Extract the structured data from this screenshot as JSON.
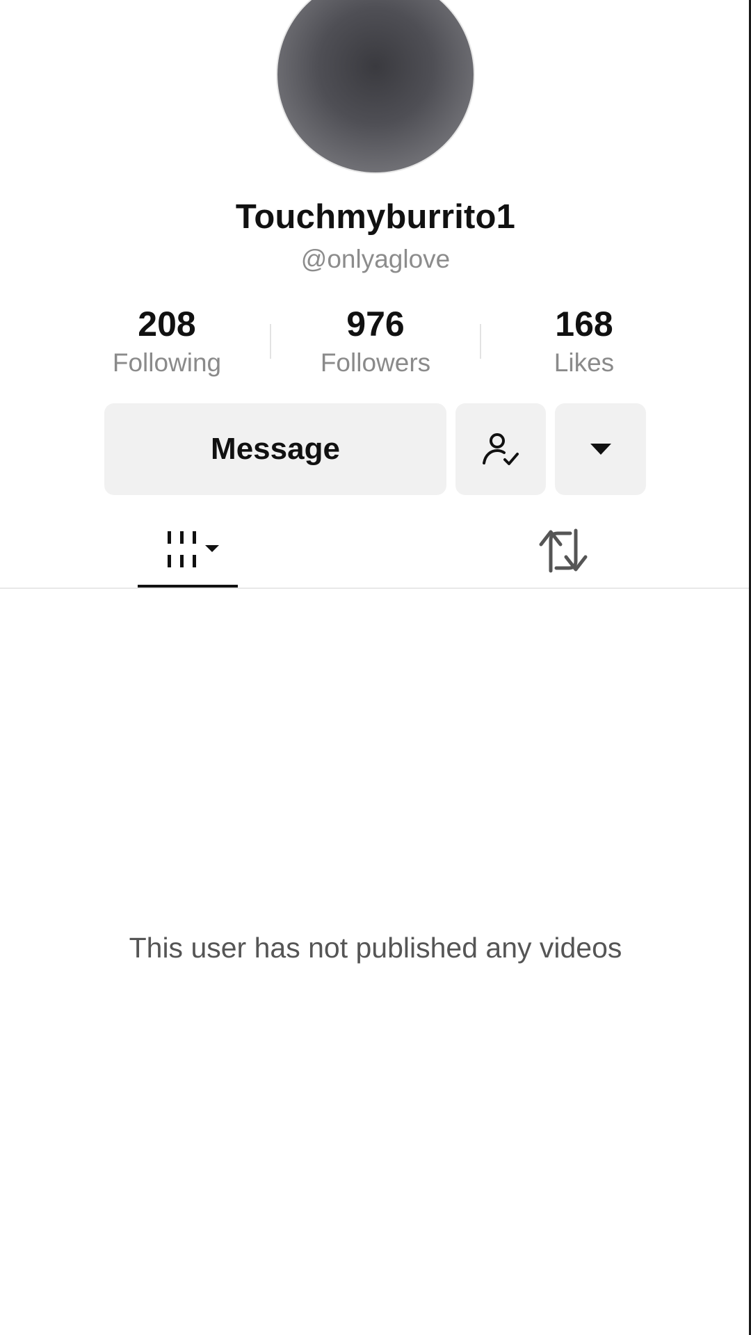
{
  "profile": {
    "display_name": "Touchmyburrito1",
    "username": "@onlyaglove"
  },
  "stats": {
    "following": {
      "value": "208",
      "label": "Following"
    },
    "followers": {
      "value": "976",
      "label": "Followers"
    },
    "likes": {
      "value": "168",
      "label": "Likes"
    }
  },
  "actions": {
    "message_label": "Message",
    "following_icon": "person-check-icon",
    "more_icon": "caret-down-icon"
  },
  "tabs": [
    {
      "name": "videos",
      "icon": "video-grid-icon",
      "selected": true
    },
    {
      "name": "reposts",
      "icon": "repost-icon",
      "selected": false
    }
  ],
  "content": {
    "empty_message": "This user has not published any videos"
  },
  "colors": {
    "button_bg": "#f1f1f1",
    "primary_text": "#111111",
    "secondary_text": "#8a8a8a"
  }
}
